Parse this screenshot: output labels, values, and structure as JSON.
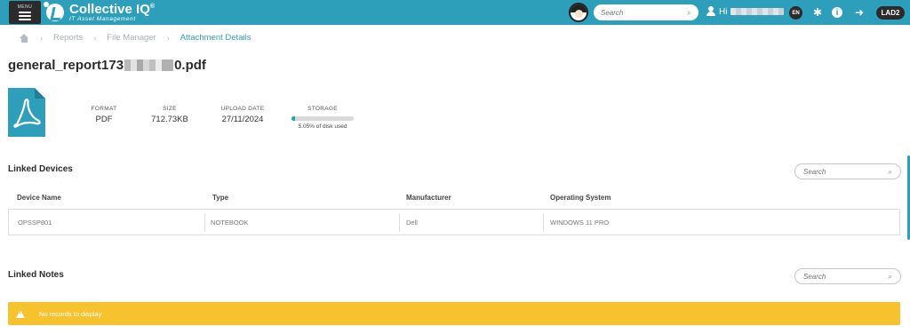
{
  "app": {
    "menu_label": "MENU",
    "brand_title": "Collective IQ",
    "brand_trademark": "®",
    "brand_subtitle": "IT Asset Management"
  },
  "header": {
    "search_placeholder": "Search",
    "greeting": "Hi",
    "language": "EN",
    "tenant_badge": "LAD2"
  },
  "breadcrumb": {
    "items": [
      "Reports",
      "File Manager",
      "Attachment Details"
    ]
  },
  "file": {
    "name_prefix": "general_report173",
    "name_suffix": "0.pdf",
    "format_label": "FORMAT",
    "format_value": "PDF",
    "size_label": "SIZE",
    "size_value": "712.73KB",
    "upload_label": "UPLOAD DATE",
    "upload_value": "27/11/2024",
    "storage_label": "STORAGE",
    "storage_note": "5.05% of disk used",
    "storage_used_fraction": 0.0505
  },
  "linked_devices": {
    "title": "Linked Devices",
    "search_placeholder": "Search",
    "columns": [
      "Device Name",
      "Type",
      "Manufacturer",
      "Operating System"
    ],
    "rows": [
      [
        "OPSSP801",
        "NOTEBOOK",
        "Dell",
        "WINDOWS 11 PRO"
      ]
    ]
  },
  "linked_notes": {
    "title": "Linked Notes",
    "search_placeholder": "Search",
    "empty_message": "No records to display"
  },
  "colors": {
    "brand": "#2e9fba",
    "warning": "#f6c22e",
    "dark": "#2b2b2b",
    "pdf": "#2e9fba"
  }
}
